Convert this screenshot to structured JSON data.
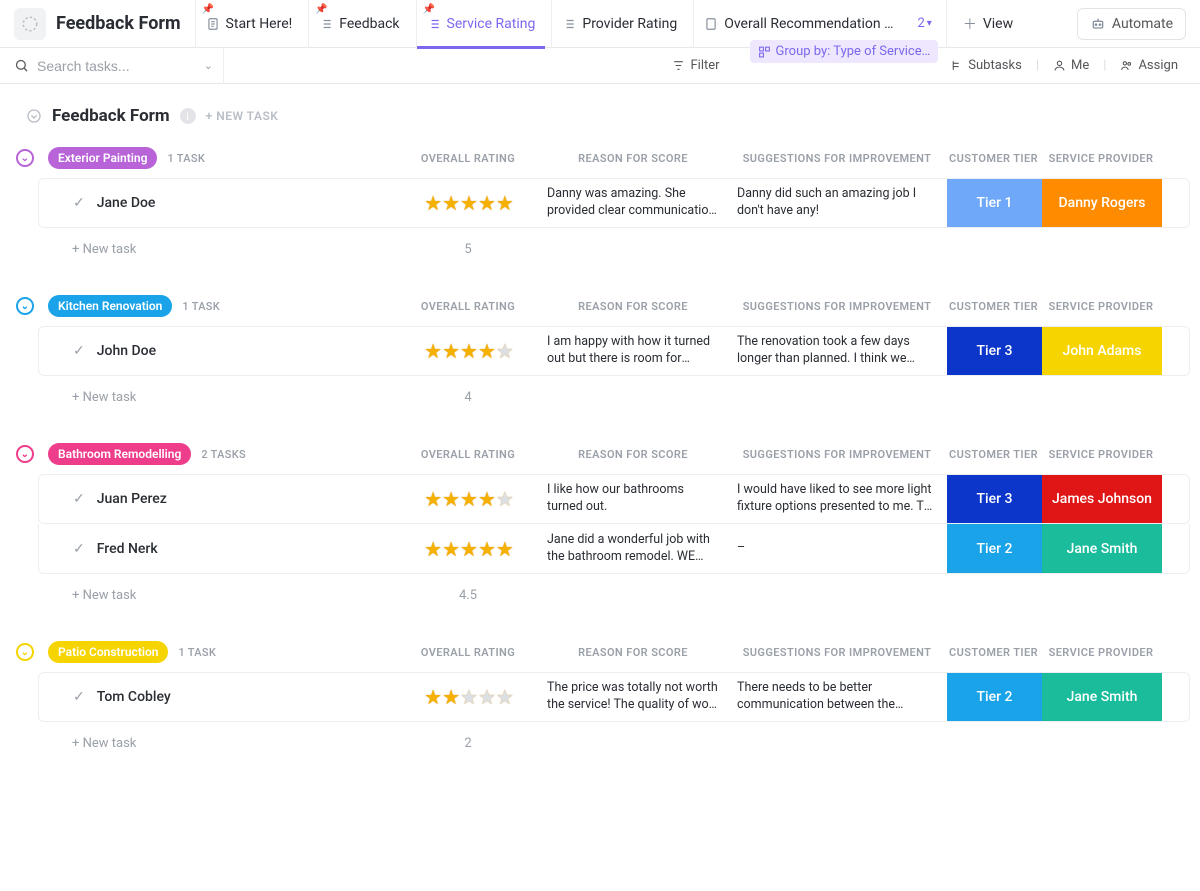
{
  "header": {
    "title": "Feedback Form",
    "tabs": [
      {
        "label": "Start Here!"
      },
      {
        "label": "Feedback"
      },
      {
        "label": "Service Rating"
      },
      {
        "label": "Provider Rating"
      },
      {
        "label": "Overall Recommendation …"
      }
    ],
    "more_count": "2",
    "view_label": "View",
    "automate_label": "Automate"
  },
  "toolbar": {
    "search_placeholder": "Search tasks...",
    "filter": "Filter",
    "group": "Group by: Type of Service…",
    "subtasks": "Subtasks",
    "me": "Me",
    "assign": "Assign"
  },
  "list": {
    "title": "Feedback Form",
    "new_task_label": "+ NEW TASK",
    "columns": {
      "overall": "OVERALL RATING",
      "reason": "REASON FOR SCORE",
      "suggestions": "SUGGESTIONS FOR IMPROVEMENT",
      "tier": "CUSTOMER TIER",
      "provider": "SERVICE PROVIDER"
    },
    "new_task_row": "+ New task"
  },
  "groups": [
    {
      "name": "Exterior Painting",
      "pill_color": "#b864d8",
      "chev_color": "#b864d8",
      "count_label": "1 TASK",
      "average": "5",
      "rows": [
        {
          "name": "Jane Doe",
          "stars": 5,
          "reason": "Danny was amazing. She provided clear communication of time…",
          "suggestions": "Danny did such an amazing job I don't have any!",
          "tier": "Tier 1",
          "tier_color": "#6fa8f8",
          "provider": "Danny Rogers",
          "prov_color": "#ff8b00"
        }
      ]
    },
    {
      "name": "Kitchen Renovation",
      "pill_color": "#1aa3e8",
      "chev_color": "#1aa3e8",
      "count_label": "1 TASK",
      "average": "4",
      "rows": [
        {
          "name": "John Doe",
          "stars": 4,
          "reason": "I am happy with how it turned out but there is room for improvement",
          "suggestions": "The renovation took a few days longer than planned. I think we could have finished on …",
          "tier": "Tier 3",
          "tier_color": "#0b36c9",
          "provider": "John Adams",
          "prov_color": "#f5d400"
        }
      ]
    },
    {
      "name": "Bathroom Remodelling",
      "pill_color": "#ee3d8b",
      "chev_color": "#ee3d8b",
      "count_label": "2 TASKS",
      "average": "4.5",
      "rows": [
        {
          "name": "Juan Perez",
          "stars": 4,
          "reason": "I like how our bathrooms turned out.",
          "suggestions": "I would have liked to see more light fixture options presented to me. The options provided…",
          "tier": "Tier 3",
          "tier_color": "#0b36c9",
          "provider": "James Johnson",
          "prov_color": "#e01515"
        },
        {
          "name": "Fred Nerk",
          "stars": 5,
          "reason": "Jane did a wonderful job with the bathroom remodel. WE LOVE IT!",
          "suggestions": "–",
          "tier": "Tier 2",
          "tier_color": "#1aa3e8",
          "provider": "Jane Smith",
          "prov_color": "#1bbc9c"
        }
      ]
    },
    {
      "name": "Patio Construction",
      "pill_color": "#f5d400",
      "chev_color": "#f5d400",
      "count_label": "1 TASK",
      "average": "2",
      "rows": [
        {
          "name": "Tom Cobley",
          "stars": 2,
          "reason": "The price was totally not worth the service! The quality of work …",
          "suggestions": "There needs to be better communication between the designer and the people doing the…",
          "tier": "Tier 2",
          "tier_color": "#1aa3e8",
          "provider": "Jane Smith",
          "prov_color": "#1bbc9c"
        }
      ]
    }
  ]
}
